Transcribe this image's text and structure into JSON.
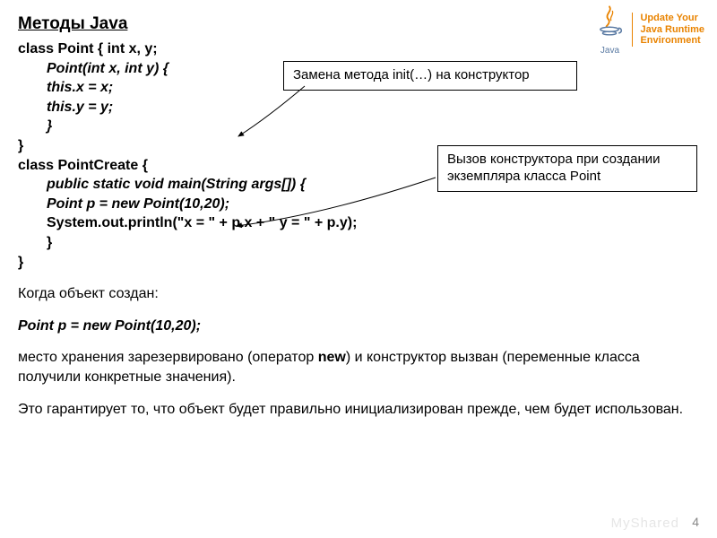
{
  "title": "Методы Java",
  "logo": {
    "label": "Java",
    "line1": "Update Your",
    "line2": "Java Runtime",
    "line3": "Environment"
  },
  "code": {
    "l1": "class Point { int x, y;",
    "l2": "Point(int x, int y) {",
    "l3": "this.x = x;",
    "l4": "this.y = y;",
    "l5": "}",
    "l6": "}",
    "l7": "class PointCreate {",
    "l8": "public static void main(String args[]) {",
    "l9": "Point p = new Point(10,20);",
    "l10": "System.out.println(\"x = \" + p.x + \" y = \" + p.y);",
    "l11": "}",
    "l12": "}"
  },
  "callout1": "Замена метода init(…) на конструктор",
  "callout2": "Вызов конструктора при создании экземпляра класса Point",
  "explain": {
    "p1": "Когда объект создан:",
    "p2": "Point p = new Point(10,20);",
    "p3a": "место хранения зарезервировано (оператор ",
    "p3b": "new",
    "p3c": ") и конструктор вызван (переменные класса получили конкретные значения).",
    "p4": "Это гарантирует то, что объект будет правильно инициализирован прежде, чем будет использован."
  },
  "page_num": "4",
  "watermark": "MyShared"
}
